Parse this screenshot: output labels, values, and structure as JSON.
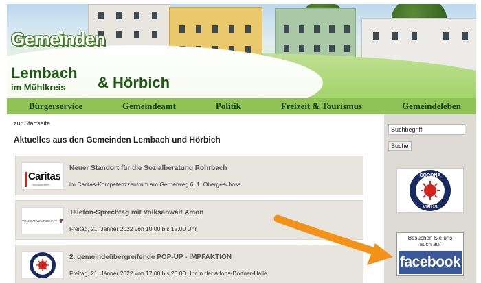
{
  "banner": {
    "title_line1": "Gemeinden",
    "title_line2": "Lembach",
    "title_line3": "im Mühlkreis",
    "title_line4": "& Hörbich"
  },
  "nav": {
    "items": [
      {
        "label": "Bürgerservice"
      },
      {
        "label": "Gemeindeamt"
      },
      {
        "label": "Politik"
      },
      {
        "label": "Freizeit & Tourismus"
      },
      {
        "label": "Gemeindeleben"
      }
    ]
  },
  "main": {
    "breadcrumb": "zur Startseite",
    "heading": "Aktuelles aus den Gemeinden Lembach und Hörbich",
    "news": [
      {
        "title": "Neuer Standort für die Sozialberatung Rohrbach",
        "text": "im Caritas-Kompetenzzentrum am Gerberweg 6, 1. Obergeschoss",
        "logo_text": "Caritas",
        "logo_sub": "Oberösterreich"
      },
      {
        "title": "Telefon-Sprechtag mit Volksanwalt Amon",
        "text": "Freitag, 21. Jänner 2022 von 10.00 bis 12.00 Uhr",
        "logo_text": "VOLKSANWALTSCHAFT"
      },
      {
        "title": "2. gemeindeübergreifende POP-UP - IMPFAKTION",
        "text": "Freitag, 21. Jänner 2022 von 17.00 bis 20.00 Uhr in der Alfons-Dorfner-Halle"
      }
    ]
  },
  "sidebar": {
    "search_value": "Suchbegriff",
    "search_button": "Suche",
    "corona_top": "CORONA",
    "corona_bottom": "VIRUS",
    "facebook_caption_line1": "Besuchen Sie uns",
    "facebook_caption_line2": "auch auf",
    "facebook_logo": "facebook"
  },
  "colors": {
    "nav_green": "#8fc356",
    "banner_dark_green": "#1f5a14",
    "facebook_blue": "#3b5998",
    "arrow_orange": "#f29219",
    "caritas_red": "#d2231f",
    "corona_navy": "#1b2a5e"
  }
}
